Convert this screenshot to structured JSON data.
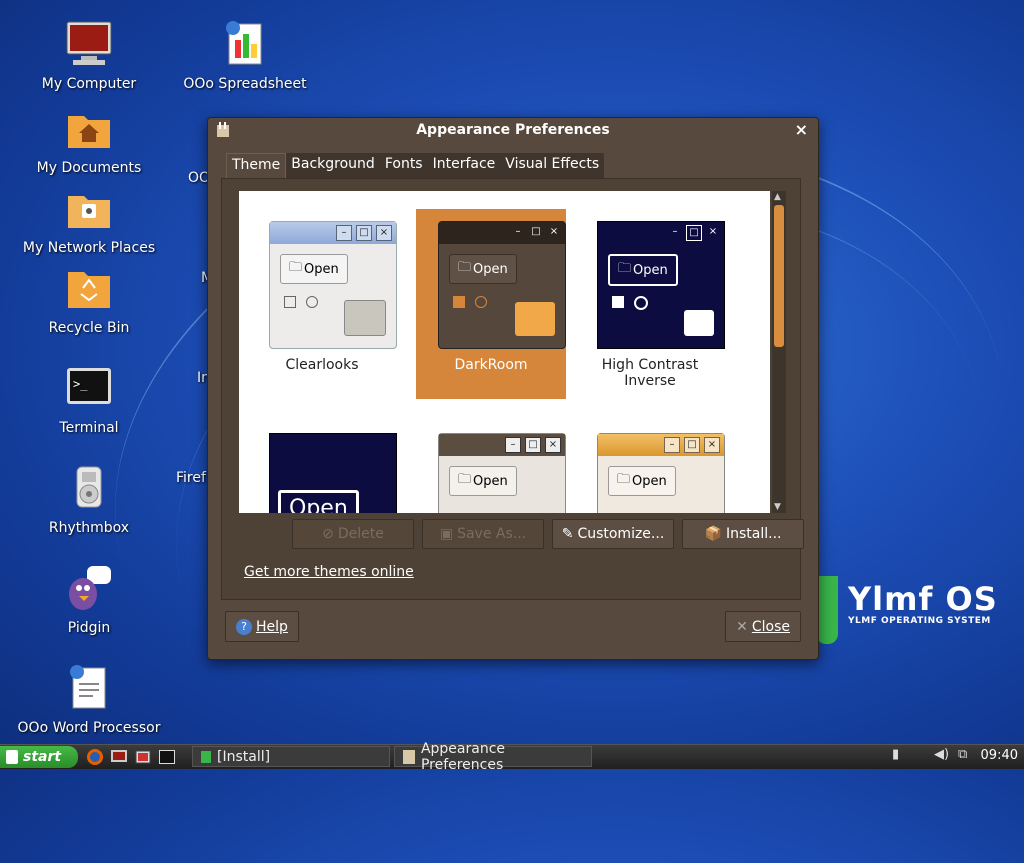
{
  "desktop": {
    "icons": [
      {
        "name": "my-computer",
        "label": "My Computer"
      },
      {
        "name": "ooo-spreadsheet",
        "label": "OOo Spreadsheet"
      },
      {
        "name": "my-documents",
        "label": "My Documents"
      },
      {
        "name": "my-network-places",
        "label": "My Network Places"
      },
      {
        "name": "recycle-bin",
        "label": "Recycle Bin"
      },
      {
        "name": "terminal",
        "label": "Terminal"
      },
      {
        "name": "rhythmbox",
        "label": "Rhythmbox"
      },
      {
        "name": "pidgin",
        "label": "Pidgin"
      },
      {
        "name": "ooo-word-processor",
        "label": "OOo Word Processor"
      }
    ],
    "partial_labels": [
      "OO",
      "M",
      "In",
      "Firef"
    ],
    "brand": {
      "title": "Ylmf OS",
      "subtitle": "YLMF OPERATING SYSTEM"
    }
  },
  "window": {
    "title": "Appearance Preferences",
    "close_glyph": "×",
    "tabs": [
      "Theme",
      "Background",
      "Fonts",
      "Interface",
      "Visual Effects"
    ],
    "active_tab": "Theme",
    "themes": [
      {
        "label": "Clearlooks",
        "selected": false
      },
      {
        "label": "DarkRoom",
        "selected": true
      },
      {
        "label": "High Contrast Inverse",
        "selected": false
      },
      {
        "label": "",
        "selected": false
      },
      {
        "label": "",
        "selected": false
      },
      {
        "label": "",
        "selected": false
      }
    ],
    "preview_open_label": "Open",
    "buttons": {
      "delete": "Delete",
      "save_as": "Save As...",
      "customize": "Customize...",
      "install": "Install..."
    },
    "link": "Get more themes online",
    "help": "Help",
    "close": "Close"
  },
  "taskbar": {
    "start": "start",
    "tasks": [
      "[Install]",
      "Appearance Preferences"
    ],
    "clock": "09:40"
  },
  "colors": {
    "accent": "#d6863a",
    "window_bg": "#57493d",
    "desktop": "#1d4fb8"
  }
}
